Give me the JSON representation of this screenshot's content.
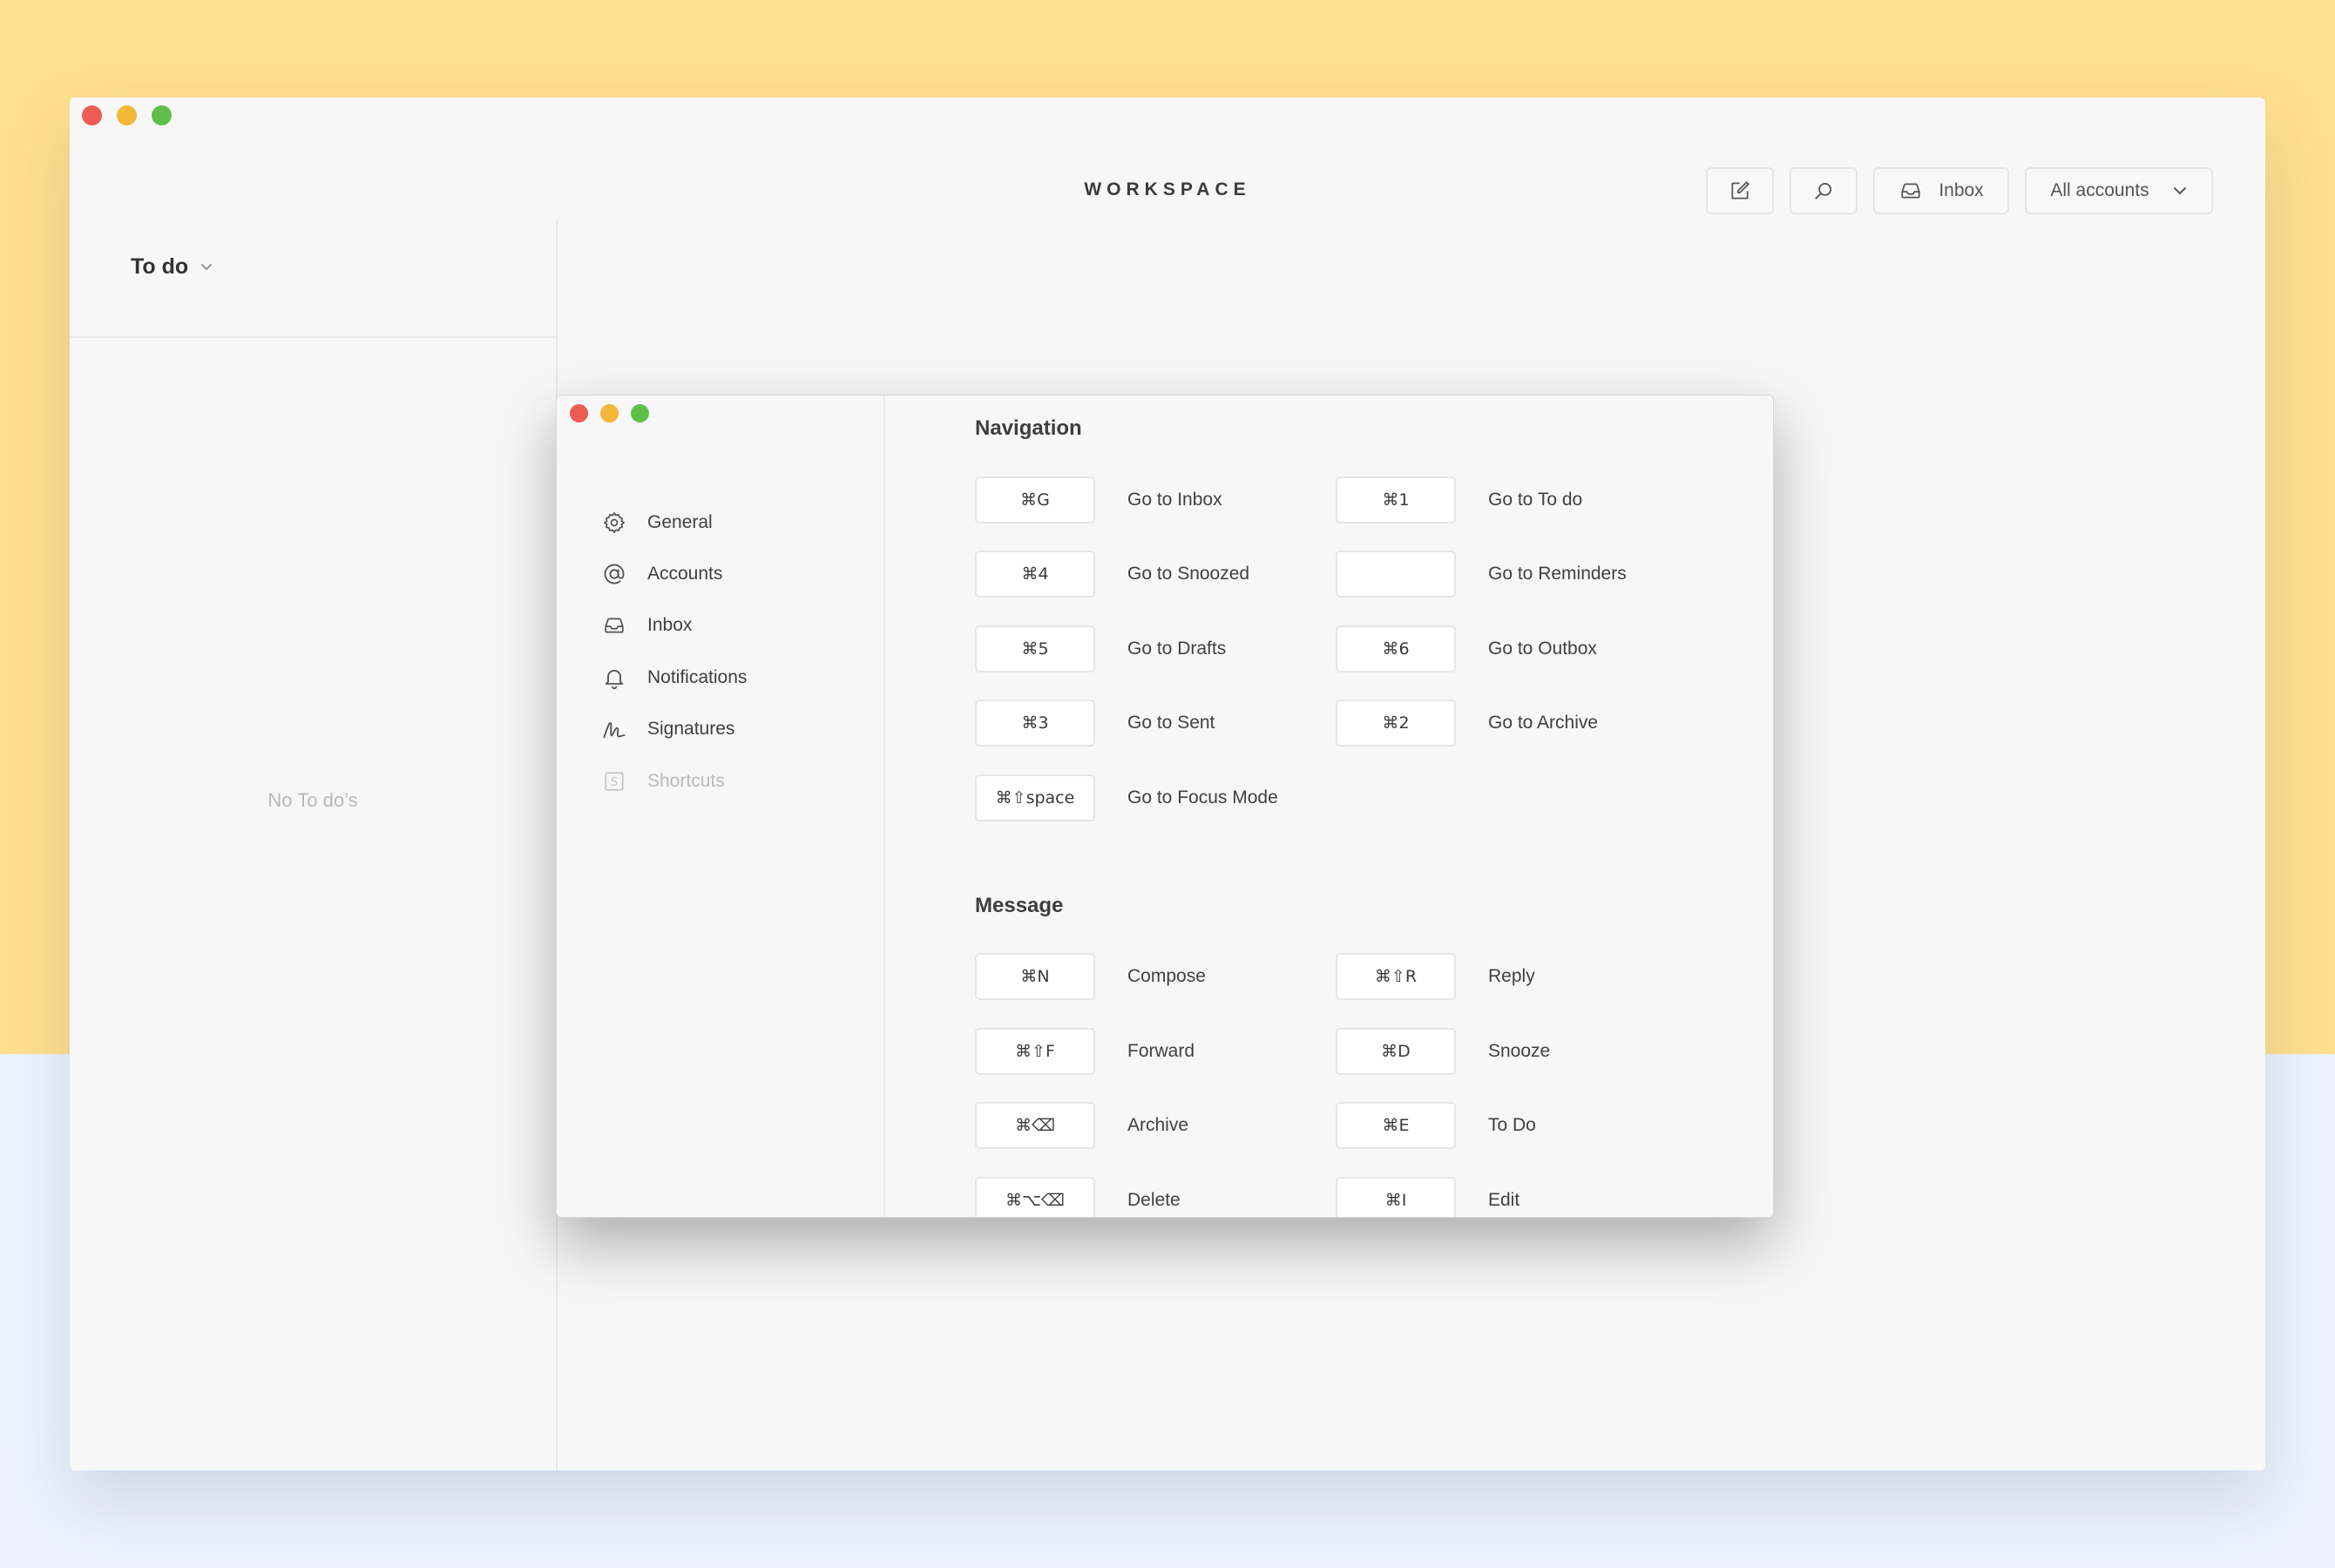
{
  "colors": {
    "background_top": "#ffe08e",
    "background_bottom": "#ecf3fc",
    "window": "#f7f7f7",
    "traffic_red": "#ee5b52",
    "traffic_yellow": "#f4b73a",
    "traffic_green": "#5ec04b"
  },
  "main": {
    "title": "WORKSPACE",
    "toolbar": {
      "compose_icon": "compose-icon",
      "search_icon": "search-icon",
      "inbox_label": "Inbox",
      "accounts_label": "All accounts"
    },
    "left_pane": {
      "header": "To do",
      "empty_text": "No To do’s"
    }
  },
  "preferences": {
    "nav": [
      {
        "label": "General",
        "icon": "gear-icon",
        "active": false
      },
      {
        "label": "Accounts",
        "icon": "at-icon",
        "active": false
      },
      {
        "label": "Inbox",
        "icon": "inbox-icon",
        "active": false
      },
      {
        "label": "Notifications",
        "icon": "bell-icon",
        "active": false
      },
      {
        "label": "Signatures",
        "icon": "signature-icon",
        "active": false
      },
      {
        "label": "Shortcuts",
        "icon": "shortcut-icon",
        "active": true
      }
    ],
    "sections": {
      "navigation": {
        "title": "Navigation",
        "rows": [
          [
            {
              "key": "⌘G",
              "label": "Go to Inbox"
            },
            {
              "key": "⌘1",
              "label": "Go to To do"
            }
          ],
          [
            {
              "key": "⌘4",
              "label": "Go to Snoozed"
            },
            {
              "key": "",
              "label": "Go to Reminders"
            }
          ],
          [
            {
              "key": "⌘5",
              "label": "Go to Drafts"
            },
            {
              "key": "⌘6",
              "label": "Go to Outbox"
            }
          ],
          [
            {
              "key": "⌘3",
              "label": "Go to Sent"
            },
            {
              "key": "⌘2",
              "label": "Go to Archive"
            }
          ],
          [
            {
              "key": "⌘⇧space",
              "label": "Go to Focus Mode"
            }
          ]
        ]
      },
      "message": {
        "title": "Message",
        "rows": [
          [
            {
              "key": "⌘N",
              "label": "Compose"
            },
            {
              "key": "⌘⇧R",
              "label": "Reply"
            }
          ],
          [
            {
              "key": "⌘⇧F",
              "label": "Forward"
            },
            {
              "key": "⌘D",
              "label": "Snooze"
            }
          ],
          [
            {
              "key": "⌘⌫",
              "label": "Archive"
            },
            {
              "key": "⌘E",
              "label": "To Do"
            }
          ],
          [
            {
              "key": "⌘⌥⌫",
              "label": "Delete"
            },
            {
              "key": "⌘I",
              "label": "Edit"
            }
          ]
        ]
      }
    }
  }
}
